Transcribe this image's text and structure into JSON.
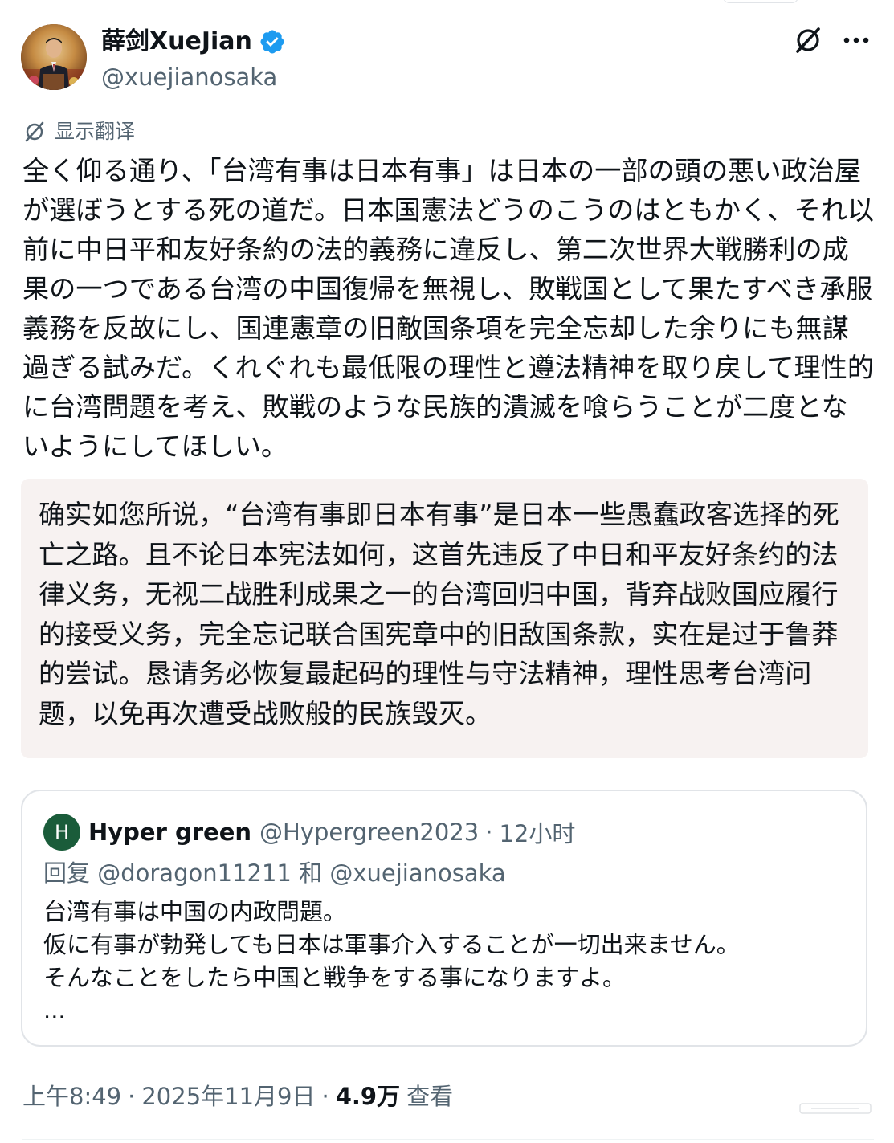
{
  "author": {
    "display_name": "薛剑XueJian",
    "handle": "@xuejianosaka",
    "avatar_icon": "person-portrait",
    "verified_color": "#1d9bf0"
  },
  "actions": {
    "grok_icon": "grok-icon",
    "more_icon": "more-horizontal-icon"
  },
  "translate": {
    "label": "显示翻译",
    "icon": "translate-icon"
  },
  "post": {
    "text": "全く仰る通り、「台湾有事は日本有事」は日本の一部の頭の悪い政治屋が選ぼうとする死の道だ。日本国憲法どうのこうのはともかく、それ以前に中日平和友好条約の法的義務に違反し、第二次世界大戦勝利の成果の一つである台湾の中国復帰を無視し、敗戦国として果たすべき承服義務を反故にし、国連憲章の旧敵国条項を完全忘却した余りにも無謀過ぎる試みだ。くれぐれも最低限の理性と遵法精神を取り戻して理性的に台湾問題を考え、敗戦のような民族的潰滅を喰らうことが二度とないようにしてほしい。"
  },
  "translation": {
    "text": "确实如您所说，“台湾有事即日本有事”是日本一些愚蠢政客选择的死亡之路。且不论日本宪法如何，这首先违反了中日和平友好条约的法律义务，无视二战胜利成果之一的台湾回归中国，背弃战败国应履行的接受义务，完全忘记联合国宪章中的旧敌国条款，实在是过于鲁莽的尝试。恳请务必恢复最起码的理性与守法精神，理性思考台湾问题，以免再次遭受战败般的民族毁灭。",
    "background_color": "#f7f2f1"
  },
  "quoted": {
    "avatar_letter": "H",
    "avatar_color": "#1a5c3a",
    "name": "Hyper green",
    "handle": "@Hypergreen2023",
    "separator": "·",
    "time": "12小时",
    "reply_prefix": "回复",
    "reply_mention_1": "@doragon11211",
    "reply_and": "和",
    "reply_mention_2": "@xuejianosaka",
    "body": "台湾有事は中国の内政問題。\n仮に有事が勃発しても日本は軍事介入することが一切出来ません。\nそんなことをしたら中国と戦争をする事になりますよ。\n..."
  },
  "meta": {
    "time": "上午8:49",
    "separator": "·",
    "date": "2025年11月9日",
    "views_count": "4.9万",
    "views_label": "查看"
  }
}
